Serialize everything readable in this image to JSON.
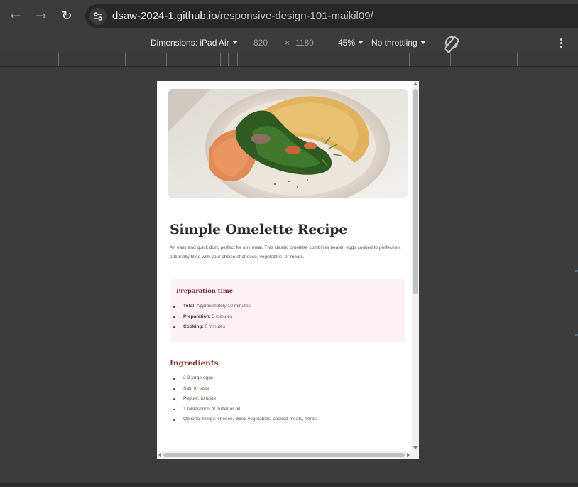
{
  "browser": {
    "url_host": "dsaw-2024-1.github.io",
    "url_path": "/responsive-design-101-maikil09/",
    "icons": [
      "back-arrow-icon",
      "forward-arrow-icon",
      "reload-icon",
      "site-settings-icon"
    ]
  },
  "device_toolbar": {
    "dimensions_label": "Dimensions: iPad Air",
    "width": "820",
    "times": "×",
    "height": "1180",
    "zoom": "45%",
    "throttling": "No throttling",
    "icons": [
      "rotate-icon",
      "more-options-icon"
    ]
  },
  "page": {
    "title": "Simple Omelette Recipe",
    "description": "An easy and quick dish, perfect for any meal. This classic omelette combines beaten eggs cooked to perfection, optionally filled with your choice of cheese, vegetables, or meats.",
    "preparation": {
      "heading": "Preparation time",
      "items": [
        {
          "label": "Total:",
          "value": "Approximately 10 minutes"
        },
        {
          "label": "Preparation:",
          "value": "5 minutes"
        },
        {
          "label": "Cooking:",
          "value": "5 minutes"
        }
      ]
    },
    "ingredients": {
      "heading": "Ingredients",
      "items": [
        "2-3 large eggs",
        "Salt, to taste",
        "Pepper, to taste",
        "1 tablespoon of butter or oil",
        "Optional fillings: cheese, diced vegetables, cooked meats, herbs"
      ]
    },
    "colors": {
      "title": "#2c2a28",
      "prep_heading": "#7a2a47",
      "prep_background": "#fdf1f5",
      "ingredients_heading": "#85392d"
    }
  }
}
